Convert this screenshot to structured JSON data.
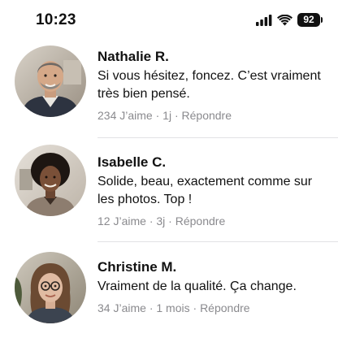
{
  "status_bar": {
    "time": "10:23",
    "battery": "92",
    "icons": [
      "cellular-signal-icon",
      "wifi-icon",
      "battery-icon"
    ]
  },
  "comments": [
    {
      "author": "Nathalie R.",
      "text": "Si vous hésitez, foncez. C’est vraiment très bien pensé.",
      "likes": "234 J’aime",
      "time": "1j",
      "reply": "Répondre"
    },
    {
      "author": "Isabelle C.",
      "text": "Solide, beau, exactement comme sur les photos. Top !",
      "likes": "12 J’aime",
      "time": "3j",
      "reply": "Répondre"
    },
    {
      "author": "Christine M.",
      "text": "Vraiment de la qualité. Ça change.",
      "likes": "34 J’aime",
      "time": "1 mois",
      "reply": "Répondre"
    }
  ],
  "meta_separator": "·",
  "colors": {
    "text": "#111111",
    "meta": "#8a8a8e",
    "divider": "#e2e2e5",
    "background": "#ffffff"
  }
}
